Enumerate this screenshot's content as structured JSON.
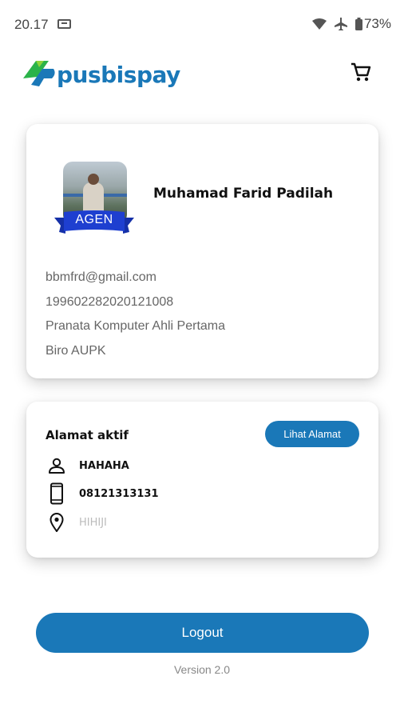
{
  "status_bar": {
    "time": "20.17",
    "battery": "73%",
    "icons": [
      "sim-card-icon",
      "wifi-icon",
      "airplane-icon",
      "battery-icon"
    ]
  },
  "header": {
    "logo_text": "pusbispay",
    "cart_icon": "cart-icon"
  },
  "profile": {
    "badge": "AGEN",
    "name": "Muhamad Farid Padilah",
    "email": "bbmfrd@gmail.com",
    "nip": "199602282020121008",
    "position": "Pranata Komputer Ahli Pertama",
    "unit": "Biro AUPK"
  },
  "address": {
    "title": "Alamat aktif",
    "button_label": "Lihat Alamat",
    "recipient": "HAHAHA",
    "phone": "08121313131",
    "place": "HIHIJI"
  },
  "footer": {
    "logout_label": "Logout",
    "version": "Version 2.0"
  },
  "colors": {
    "primary": "#1a78b8",
    "badge_blue": "#1e3fd0",
    "logo_green": "#2bb34a"
  }
}
